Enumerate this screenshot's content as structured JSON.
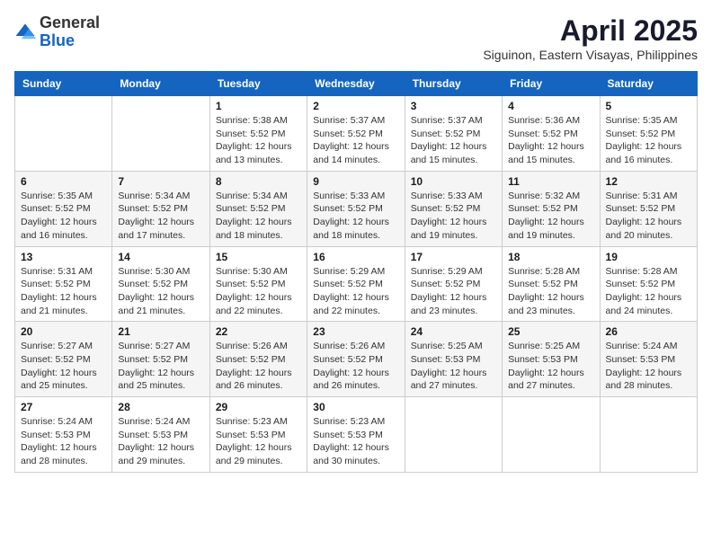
{
  "header": {
    "logo": {
      "general": "General",
      "blue": "Blue"
    },
    "month": "April 2025",
    "location": "Siguinon, Eastern Visayas, Philippines"
  },
  "weekdays": [
    "Sunday",
    "Monday",
    "Tuesday",
    "Wednesday",
    "Thursday",
    "Friday",
    "Saturday"
  ],
  "weeks": [
    [
      {
        "day": "",
        "sunrise": "",
        "sunset": "",
        "daylight": ""
      },
      {
        "day": "",
        "sunrise": "",
        "sunset": "",
        "daylight": ""
      },
      {
        "day": "1",
        "sunrise": "Sunrise: 5:38 AM",
        "sunset": "Sunset: 5:52 PM",
        "daylight": "Daylight: 12 hours and 13 minutes."
      },
      {
        "day": "2",
        "sunrise": "Sunrise: 5:37 AM",
        "sunset": "Sunset: 5:52 PM",
        "daylight": "Daylight: 12 hours and 14 minutes."
      },
      {
        "day": "3",
        "sunrise": "Sunrise: 5:37 AM",
        "sunset": "Sunset: 5:52 PM",
        "daylight": "Daylight: 12 hours and 15 minutes."
      },
      {
        "day": "4",
        "sunrise": "Sunrise: 5:36 AM",
        "sunset": "Sunset: 5:52 PM",
        "daylight": "Daylight: 12 hours and 15 minutes."
      },
      {
        "day": "5",
        "sunrise": "Sunrise: 5:35 AM",
        "sunset": "Sunset: 5:52 PM",
        "daylight": "Daylight: 12 hours and 16 minutes."
      }
    ],
    [
      {
        "day": "6",
        "sunrise": "Sunrise: 5:35 AM",
        "sunset": "Sunset: 5:52 PM",
        "daylight": "Daylight: 12 hours and 16 minutes."
      },
      {
        "day": "7",
        "sunrise": "Sunrise: 5:34 AM",
        "sunset": "Sunset: 5:52 PM",
        "daylight": "Daylight: 12 hours and 17 minutes."
      },
      {
        "day": "8",
        "sunrise": "Sunrise: 5:34 AM",
        "sunset": "Sunset: 5:52 PM",
        "daylight": "Daylight: 12 hours and 18 minutes."
      },
      {
        "day": "9",
        "sunrise": "Sunrise: 5:33 AM",
        "sunset": "Sunset: 5:52 PM",
        "daylight": "Daylight: 12 hours and 18 minutes."
      },
      {
        "day": "10",
        "sunrise": "Sunrise: 5:33 AM",
        "sunset": "Sunset: 5:52 PM",
        "daylight": "Daylight: 12 hours and 19 minutes."
      },
      {
        "day": "11",
        "sunrise": "Sunrise: 5:32 AM",
        "sunset": "Sunset: 5:52 PM",
        "daylight": "Daylight: 12 hours and 19 minutes."
      },
      {
        "day": "12",
        "sunrise": "Sunrise: 5:31 AM",
        "sunset": "Sunset: 5:52 PM",
        "daylight": "Daylight: 12 hours and 20 minutes."
      }
    ],
    [
      {
        "day": "13",
        "sunrise": "Sunrise: 5:31 AM",
        "sunset": "Sunset: 5:52 PM",
        "daylight": "Daylight: 12 hours and 21 minutes."
      },
      {
        "day": "14",
        "sunrise": "Sunrise: 5:30 AM",
        "sunset": "Sunset: 5:52 PM",
        "daylight": "Daylight: 12 hours and 21 minutes."
      },
      {
        "day": "15",
        "sunrise": "Sunrise: 5:30 AM",
        "sunset": "Sunset: 5:52 PM",
        "daylight": "Daylight: 12 hours and 22 minutes."
      },
      {
        "day": "16",
        "sunrise": "Sunrise: 5:29 AM",
        "sunset": "Sunset: 5:52 PM",
        "daylight": "Daylight: 12 hours and 22 minutes."
      },
      {
        "day": "17",
        "sunrise": "Sunrise: 5:29 AM",
        "sunset": "Sunset: 5:52 PM",
        "daylight": "Daylight: 12 hours and 23 minutes."
      },
      {
        "day": "18",
        "sunrise": "Sunrise: 5:28 AM",
        "sunset": "Sunset: 5:52 PM",
        "daylight": "Daylight: 12 hours and 23 minutes."
      },
      {
        "day": "19",
        "sunrise": "Sunrise: 5:28 AM",
        "sunset": "Sunset: 5:52 PM",
        "daylight": "Daylight: 12 hours and 24 minutes."
      }
    ],
    [
      {
        "day": "20",
        "sunrise": "Sunrise: 5:27 AM",
        "sunset": "Sunset: 5:52 PM",
        "daylight": "Daylight: 12 hours and 25 minutes."
      },
      {
        "day": "21",
        "sunrise": "Sunrise: 5:27 AM",
        "sunset": "Sunset: 5:52 PM",
        "daylight": "Daylight: 12 hours and 25 minutes."
      },
      {
        "day": "22",
        "sunrise": "Sunrise: 5:26 AM",
        "sunset": "Sunset: 5:52 PM",
        "daylight": "Daylight: 12 hours and 26 minutes."
      },
      {
        "day": "23",
        "sunrise": "Sunrise: 5:26 AM",
        "sunset": "Sunset: 5:52 PM",
        "daylight": "Daylight: 12 hours and 26 minutes."
      },
      {
        "day": "24",
        "sunrise": "Sunrise: 5:25 AM",
        "sunset": "Sunset: 5:53 PM",
        "daylight": "Daylight: 12 hours and 27 minutes."
      },
      {
        "day": "25",
        "sunrise": "Sunrise: 5:25 AM",
        "sunset": "Sunset: 5:53 PM",
        "daylight": "Daylight: 12 hours and 27 minutes."
      },
      {
        "day": "26",
        "sunrise": "Sunrise: 5:24 AM",
        "sunset": "Sunset: 5:53 PM",
        "daylight": "Daylight: 12 hours and 28 minutes."
      }
    ],
    [
      {
        "day": "27",
        "sunrise": "Sunrise: 5:24 AM",
        "sunset": "Sunset: 5:53 PM",
        "daylight": "Daylight: 12 hours and 28 minutes."
      },
      {
        "day": "28",
        "sunrise": "Sunrise: 5:24 AM",
        "sunset": "Sunset: 5:53 PM",
        "daylight": "Daylight: 12 hours and 29 minutes."
      },
      {
        "day": "29",
        "sunrise": "Sunrise: 5:23 AM",
        "sunset": "Sunset: 5:53 PM",
        "daylight": "Daylight: 12 hours and 29 minutes."
      },
      {
        "day": "30",
        "sunrise": "Sunrise: 5:23 AM",
        "sunset": "Sunset: 5:53 PM",
        "daylight": "Daylight: 12 hours and 30 minutes."
      },
      {
        "day": "",
        "sunrise": "",
        "sunset": "",
        "daylight": ""
      },
      {
        "day": "",
        "sunrise": "",
        "sunset": "",
        "daylight": ""
      },
      {
        "day": "",
        "sunrise": "",
        "sunset": "",
        "daylight": ""
      }
    ]
  ]
}
